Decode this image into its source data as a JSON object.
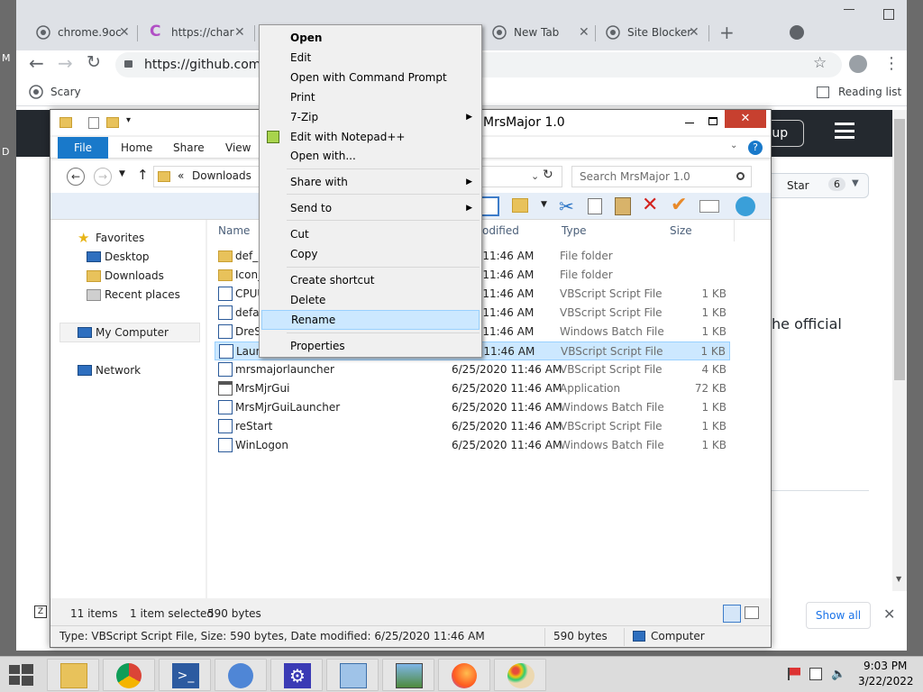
{
  "browser": {
    "tabs": [
      {
        "label": "chrome.9oc"
      },
      {
        "label": "https://char"
      },
      {
        "label": "New Tab"
      },
      {
        "label": "Site Blocker"
      }
    ],
    "url": "https://github.com/C",
    "bookmark": "Scary",
    "reading_list": "Reading list",
    "github": {
      "signup": "n up",
      "star_label": "Star",
      "star_count": "6",
      "text_fragment": "he official",
      "show_all": "Show all"
    }
  },
  "explorer": {
    "title": "MrsMajor 1.0",
    "ribbon_tabs": {
      "file": "File",
      "home": "Home",
      "share": "Share",
      "view": "View"
    },
    "address_path": "Downloads",
    "address_prefix": "«",
    "search_placeholder": "Search MrsMajor 1.0",
    "nav": {
      "favorites": "Favorites",
      "desktop": "Desktop",
      "downloads": "Downloads",
      "recent": "Recent places",
      "computer": "My Computer",
      "network": "Network"
    },
    "columns": {
      "name": "Name",
      "date": "odified",
      "type": "Type",
      "size": "Size"
    },
    "files": [
      {
        "name": "def_r",
        "date": "2020 11:46 AM",
        "type": "File folder",
        "size": ""
      },
      {
        "name": "Icon_",
        "date": "2020 11:46 AM",
        "type": "File folder",
        "size": ""
      },
      {
        "name": "CPUU",
        "date": "2020 11:46 AM",
        "type": "VBScript Script File",
        "size": "1 KB"
      },
      {
        "name": "defau",
        "date": "2020 11:46 AM",
        "type": "VBScript Script File",
        "size": "1 KB"
      },
      {
        "name": "DreS",
        "date": "2020 11:46 AM",
        "type": "Windows Batch File",
        "size": "1 KB"
      },
      {
        "name": "Laun",
        "date": "2020 11:46 AM",
        "type": "VBScript Script File",
        "size": "1 KB"
      },
      {
        "name": "mrsmajorlauncher",
        "date": "6/25/2020 11:46 AM",
        "type": "VBScript Script File",
        "size": "4 KB"
      },
      {
        "name": "MrsMjrGui",
        "date": "6/25/2020 11:46 AM",
        "type": "Application",
        "size": "72 KB"
      },
      {
        "name": "MrsMjrGuiLauncher",
        "date": "6/25/2020 11:46 AM",
        "type": "Windows Batch File",
        "size": "1 KB"
      },
      {
        "name": "reStart",
        "date": "6/25/2020 11:46 AM",
        "type": "VBScript Script File",
        "size": "1 KB"
      },
      {
        "name": "WinLogon",
        "date": "6/25/2020 11:46 AM",
        "type": "Windows Batch File",
        "size": "1 KB"
      }
    ],
    "status": {
      "items": "11 items",
      "selected": "1 item selected",
      "bytes": "590 bytes"
    },
    "detail": {
      "info": "Type: VBScript Script File, Size: 590 bytes, Date modified: 6/25/2020 11:46 AM",
      "size": "590 bytes",
      "location": "Computer"
    }
  },
  "context_menu": {
    "open": "Open",
    "edit": "Edit",
    "open_cmd": "Open with Command Prompt",
    "print": "Print",
    "zip": "7-Zip",
    "notepad": "Edit with Notepad++",
    "open_with": "Open with...",
    "share_with": "Share with",
    "send_to": "Send to",
    "cut": "Cut",
    "copy": "Copy",
    "create_shortcut": "Create shortcut",
    "delete": "Delete",
    "rename": "Rename",
    "properties": "Properties"
  },
  "taskbar": {
    "time": "9:03 PM",
    "date": "3/22/2022"
  },
  "colors": {
    "accent": "#1979ca",
    "selection": "#cce8ff",
    "github_header": "#24292f"
  }
}
